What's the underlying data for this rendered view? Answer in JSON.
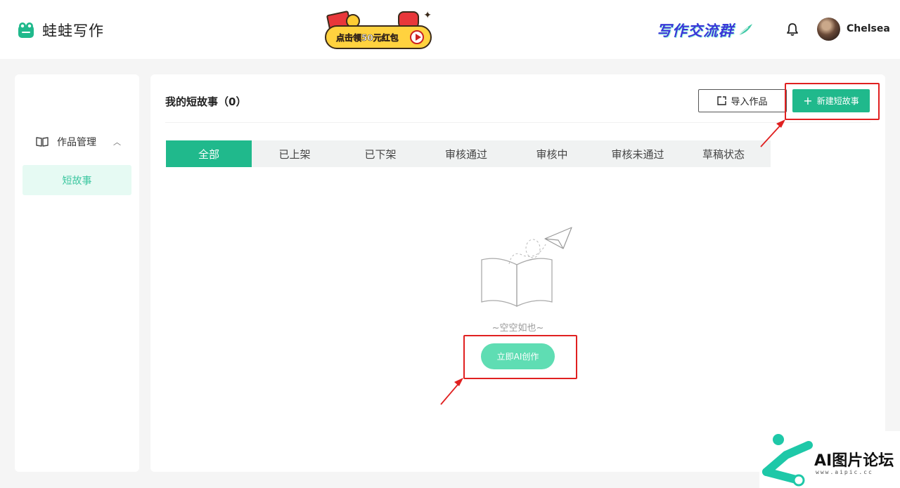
{
  "header": {
    "app_name": "蛙蛙写作",
    "promo_text": "点击领50元红包",
    "community_text": "写作交流群",
    "username": "Chelsea",
    "icons": {
      "logo": "frog-logo-icon",
      "bell": "bell-icon",
      "avatar": "user-avatar"
    }
  },
  "sidebar": {
    "group_label": "作品管理",
    "group_icon": "book-icon",
    "items": [
      {
        "label": "短故事",
        "active": true
      }
    ]
  },
  "main": {
    "title": "我的短故事（0）",
    "import_label": "导入作品",
    "new_label": "新建短故事",
    "tabs": [
      "全部",
      "已上架",
      "已下架",
      "审核通过",
      "审核中",
      "审核未通过",
      "草稿状态"
    ],
    "active_tab": 0,
    "empty_text": "~空空如也~",
    "ai_button_label": "立即AI创作"
  },
  "watermark": {
    "title": "AI图片论坛",
    "url": "www.aipic.cc"
  },
  "colors": {
    "accent": "#20b98c",
    "accent_light": "#5fddb3",
    "annotation": "#e02020",
    "community": "#3a36d8"
  }
}
